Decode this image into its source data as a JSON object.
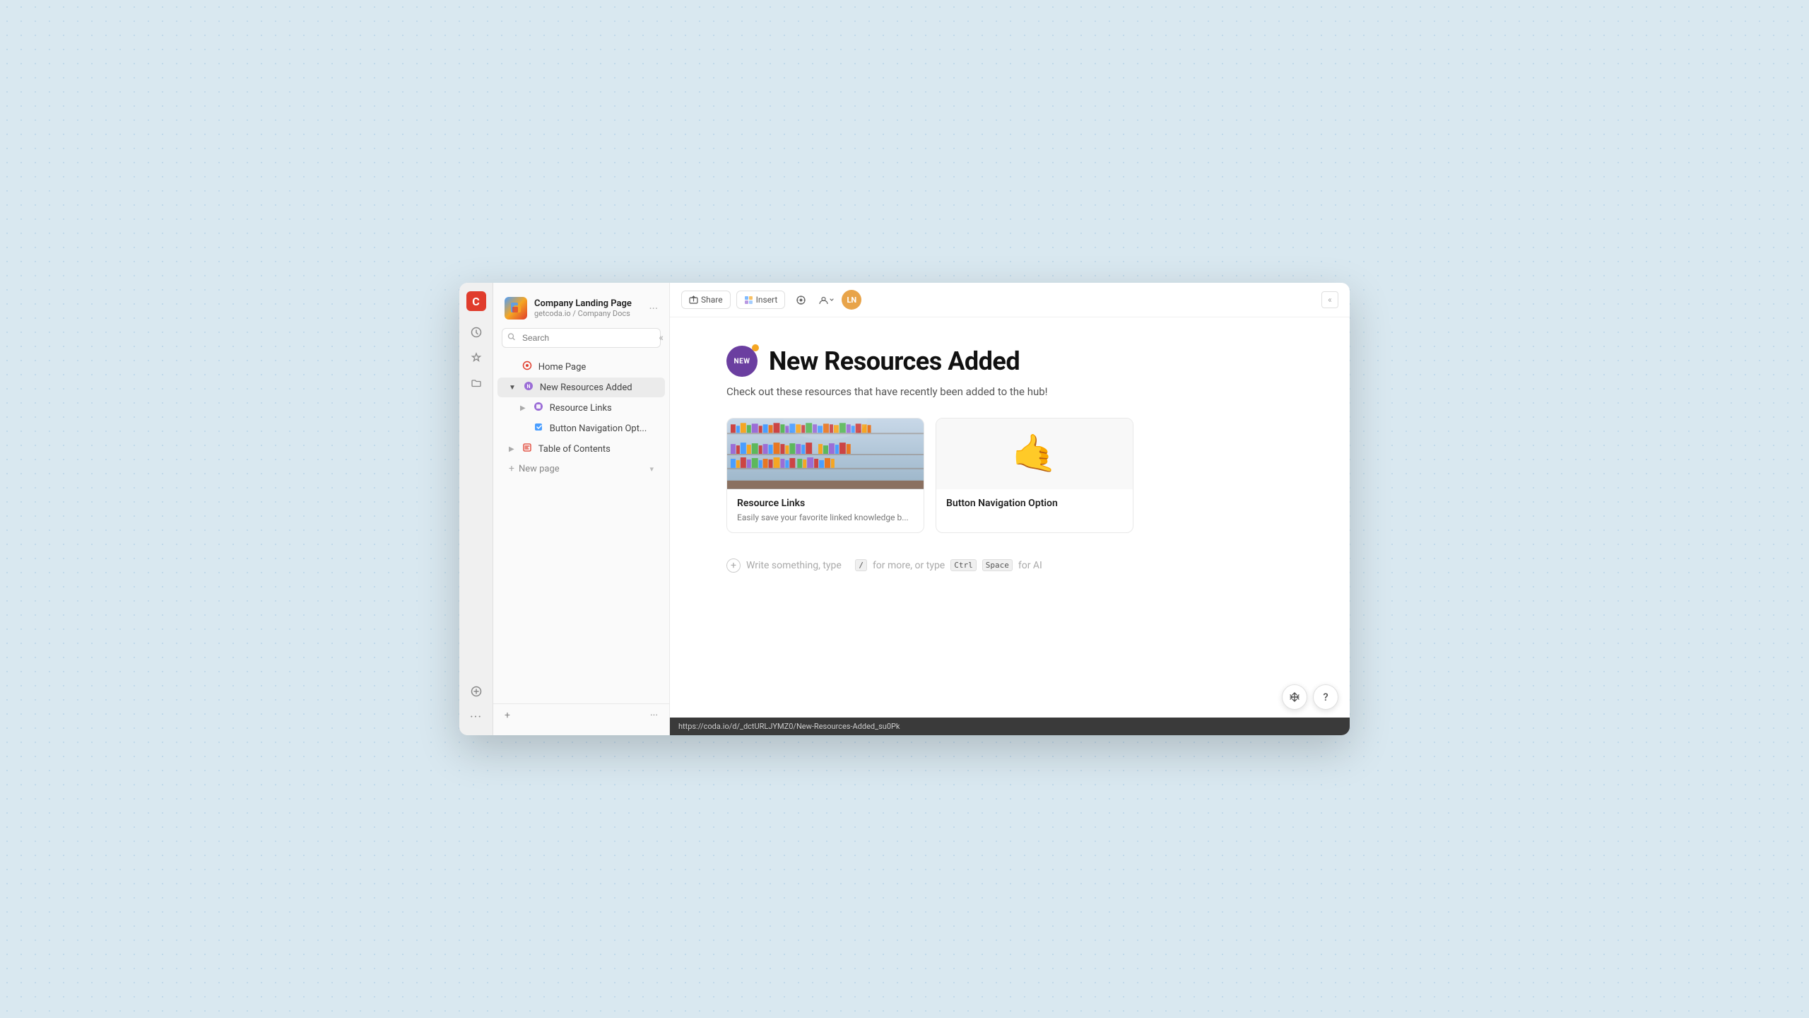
{
  "app": {
    "logo_letter": "C",
    "window_url": "https://coda.io/d/_dctURLJYMZ0/New-Resources-Added_su0Pk"
  },
  "sidebar": {
    "doc_title": "Company Landing Page",
    "doc_breadcrumb": "getcoda.io / Company Docs",
    "search_placeholder": "Search",
    "collapse_icon": "«",
    "menu_icon": "···",
    "nav_items": [
      {
        "id": "home-page",
        "label": "Home Page",
        "icon": "📍",
        "indent": 0,
        "type": "page"
      },
      {
        "id": "new-resources-added",
        "label": "New Resources Added",
        "icon": "🟣",
        "indent": 0,
        "type": "page",
        "active": true,
        "expanded": true
      },
      {
        "id": "resource-links",
        "label": "Resource Links",
        "icon": "🟣",
        "indent": 1,
        "type": "page"
      },
      {
        "id": "button-nav",
        "label": "Button Navigation Opt...",
        "icon": "🔷",
        "indent": 1,
        "type": "page"
      },
      {
        "id": "table-of-contents",
        "label": "Table of Contents",
        "icon": "📋",
        "indent": 0,
        "type": "page",
        "expandable": true
      }
    ],
    "new_page_label": "New page",
    "add_icon": "+",
    "more_icon": "···"
  },
  "topbar": {
    "share_label": "Share",
    "insert_label": "Insert",
    "settings_icon": "⚙",
    "profile_icon": "👤",
    "avatar_text": "LN",
    "collapse_icon": "«"
  },
  "page": {
    "badge_text": "NEW",
    "title": "New Resources Added",
    "subtitle": "Check out these resources that have recently been added to the hub!",
    "cards": [
      {
        "id": "resource-links-card",
        "type": "library",
        "title": "Resource Links",
        "description": "Easily save your favorite linked knowledge b..."
      },
      {
        "id": "button-nav-card",
        "type": "icon",
        "title": "Button Navigation Option",
        "description": ""
      }
    ],
    "write_prompt": "Write something, type",
    "write_slash": "/",
    "write_more": "for more, or type",
    "write_ctrl": "Ctrl",
    "write_space": "Space",
    "write_ai": "for AI"
  },
  "bottom_bar": {
    "url": "https://coda.io/d/_dctURLJYMZ0/New-Resources-Added_su0Pk"
  },
  "float_btns": {
    "move_icon": "✛",
    "help_icon": "?"
  },
  "icons": {
    "clock": "🕐",
    "star": "★",
    "folder": "📁",
    "plus": "+",
    "search": "🔍"
  }
}
